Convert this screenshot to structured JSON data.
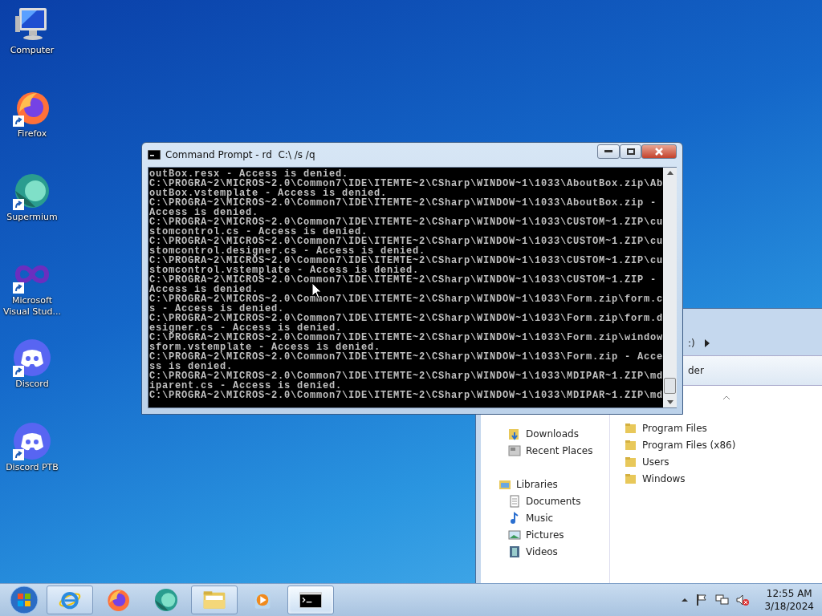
{
  "desktop_icons": [
    {
      "label": "Computer",
      "kind": "computer",
      "shortcut": false
    },
    {
      "label": "Firefox",
      "kind": "firefox",
      "shortcut": true
    },
    {
      "label": "Supermium",
      "kind": "supermium",
      "shortcut": true
    },
    {
      "label": "Microsoft Visual Stud...",
      "kind": "visualstudio",
      "shortcut": true
    },
    {
      "label": "Discord",
      "kind": "discord",
      "shortcut": true
    },
    {
      "label": "Discord PTB",
      "kind": "discord",
      "shortcut": true
    }
  ],
  "explorer": {
    "address_fragment": ":)",
    "toolbar_fragment": "der",
    "nav_items": [
      {
        "label": "Downloads",
        "kind": "downloads"
      },
      {
        "label": "Recent Places",
        "kind": "recent"
      },
      {
        "label": "Libraries",
        "kind": "library",
        "children": [
          {
            "label": "Documents",
            "kind": "documents"
          },
          {
            "label": "Music",
            "kind": "music"
          },
          {
            "label": "Pictures",
            "kind": "pictures"
          },
          {
            "label": "Videos",
            "kind": "videos"
          }
        ]
      }
    ],
    "files": [
      "Program Files",
      "Program Files (x86)",
      "Users",
      "Windows"
    ]
  },
  "console_window": {
    "title": "Command Prompt - rd  C:\\ /s /q",
    "lines": [
      "outBox.resx - Access is denied.",
      "C:\\PROGRA~2\\MICROS~2.0\\Common7\\IDE\\ITEMTE~2\\CSharp\\WINDOW~1\\1033\\AboutBox.zip\\Ab",
      "outBox.vstemplate - Access is denied.",
      "C:\\PROGRA~2\\MICROS~2.0\\Common7\\IDE\\ITEMTE~2\\CSharp\\WINDOW~1\\1033\\AboutBox.zip -",
      "Access is denied.",
      "C:\\PROGRA~2\\MICROS~2.0\\Common7\\IDE\\ITEMTE~2\\CSharp\\WINDOW~1\\1033\\CUSTOM~1.ZIP\\cu",
      "stomcontrol.cs - Access is denied.",
      "C:\\PROGRA~2\\MICROS~2.0\\Common7\\IDE\\ITEMTE~2\\CSharp\\WINDOW~1\\1033\\CUSTOM~1.ZIP\\cu",
      "stomcontrol.designer.cs - Access is denied.",
      "C:\\PROGRA~2\\MICROS~2.0\\Common7\\IDE\\ITEMTE~2\\CSharp\\WINDOW~1\\1033\\CUSTOM~1.ZIP\\cu",
      "stomcontrol.vstemplate - Access is denied.",
      "C:\\PROGRA~2\\MICROS~2.0\\Common7\\IDE\\ITEMTE~2\\CSharp\\WINDOW~1\\1033\\CUSTOM~1.ZIP -",
      "Access is denied.",
      "C:\\PROGRA~2\\MICROS~2.0\\Common7\\IDE\\ITEMTE~2\\CSharp\\WINDOW~1\\1033\\Form.zip\\form.c",
      "s - Access is denied.",
      "C:\\PROGRA~2\\MICROS~2.0\\Common7\\IDE\\ITEMTE~2\\CSharp\\WINDOW~1\\1033\\Form.zip\\form.d",
      "esigner.cs - Access is denied.",
      "C:\\PROGRA~2\\MICROS~2.0\\Common7\\IDE\\ITEMTE~2\\CSharp\\WINDOW~1\\1033\\Form.zip\\window",
      "sform.vstemplate - Access is denied.",
      "C:\\PROGRA~2\\MICROS~2.0\\Common7\\IDE\\ITEMTE~2\\CSharp\\WINDOW~1\\1033\\Form.zip - Acce",
      "ss is denied.",
      "C:\\PROGRA~2\\MICROS~2.0\\Common7\\IDE\\ITEMTE~2\\CSharp\\WINDOW~1\\1033\\MDIPAR~1.ZIP\\md",
      "iparent.cs - Access is denied.",
      "C:\\PROGRA~2\\MICROS~2.0\\Common7\\IDE\\ITEMTE~2\\CSharp\\WINDOW~1\\1033\\MDIPAR~1.ZIP\\md"
    ]
  },
  "taskbar": {
    "items": [
      {
        "kind": "ie",
        "running": true,
        "selected": false
      },
      {
        "kind": "firefox",
        "running": false,
        "selected": false
      },
      {
        "kind": "supermium",
        "running": false,
        "selected": false
      },
      {
        "kind": "explorer",
        "running": true,
        "selected": false
      },
      {
        "kind": "mediaplayer",
        "running": false,
        "selected": false
      },
      {
        "kind": "cmd",
        "running": true,
        "selected": true
      }
    ],
    "tray": [
      {
        "kind": "up"
      },
      {
        "kind": "flag"
      },
      {
        "kind": "network"
      },
      {
        "kind": "volume"
      }
    ],
    "time": "12:55 AM",
    "date": "3/18/2024"
  }
}
